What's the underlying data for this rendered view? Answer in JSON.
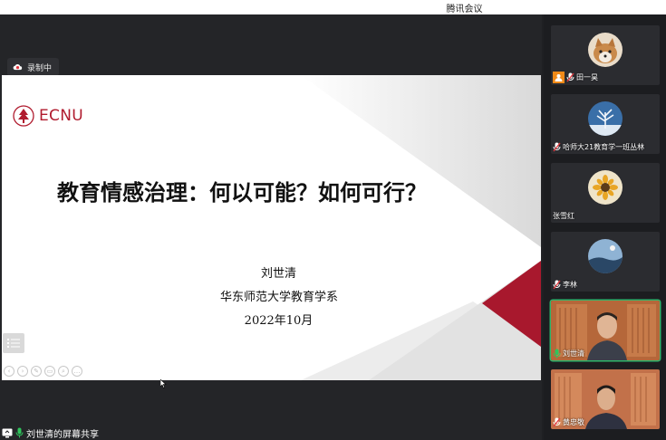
{
  "app": {
    "title": "腾讯会议"
  },
  "recording": {
    "label": "录制中",
    "icon": "cloud-record-icon"
  },
  "slide": {
    "logo_text": "ECNU",
    "title": "教育情感治理：何以可能？如何可行？",
    "author": "刘世清",
    "department": "华东师范大学教育学系",
    "date": "2022年10月",
    "accent_color": "#b01b2e"
  },
  "share": {
    "label": "刘世清的屏幕共享"
  },
  "participants": [
    {
      "name": "田一昊",
      "avatar": "dog-avatar",
      "muted": true
    },
    {
      "name": "哈师大21教育学一班丛林",
      "avatar": "winter-tree-avatar",
      "muted": true
    },
    {
      "name": "张雪红",
      "avatar": "flower-avatar",
      "muted": false
    },
    {
      "name": "李林",
      "avatar": "night-sky-avatar",
      "muted": true
    },
    {
      "name": "刘世清",
      "avatar": "video-feed",
      "muted": false,
      "speaking": true
    },
    {
      "name": "黄忠敬",
      "avatar": "video-feed",
      "muted": true
    }
  ]
}
